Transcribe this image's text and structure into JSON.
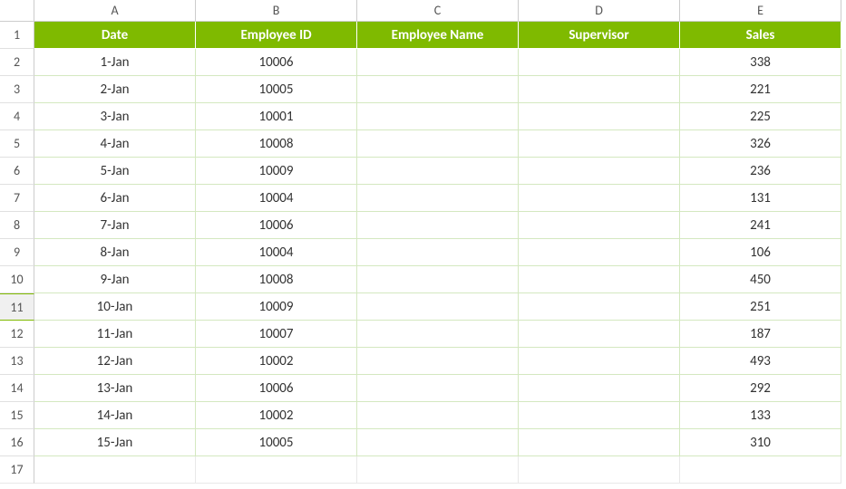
{
  "columns": [
    "A",
    "B",
    "C",
    "D",
    "E"
  ],
  "headers": {
    "A": "Date",
    "B": "Employee ID",
    "C": "Employee Name",
    "D": "Supervisor",
    "E": "Sales"
  },
  "rows": [
    {
      "n": "1"
    },
    {
      "n": "2",
      "A": "1-Jan",
      "B": "10006",
      "C": "",
      "D": "",
      "E": "338"
    },
    {
      "n": "3",
      "A": "2-Jan",
      "B": "10005",
      "C": "",
      "D": "",
      "E": "221"
    },
    {
      "n": "4",
      "A": "3-Jan",
      "B": "10001",
      "C": "",
      "D": "",
      "E": "225"
    },
    {
      "n": "5",
      "A": "4-Jan",
      "B": "10008",
      "C": "",
      "D": "",
      "E": "326"
    },
    {
      "n": "6",
      "A": "5-Jan",
      "B": "10009",
      "C": "",
      "D": "",
      "E": "236"
    },
    {
      "n": "7",
      "A": "6-Jan",
      "B": "10004",
      "C": "",
      "D": "",
      "E": "131"
    },
    {
      "n": "8",
      "A": "7-Jan",
      "B": "10006",
      "C": "",
      "D": "",
      "E": "241"
    },
    {
      "n": "9",
      "A": "8-Jan",
      "B": "10004",
      "C": "",
      "D": "",
      "E": "106"
    },
    {
      "n": "10",
      "A": "9-Jan",
      "B": "10008",
      "C": "",
      "D": "",
      "E": "450"
    },
    {
      "n": "11",
      "A": "10-Jan",
      "B": "10009",
      "C": "",
      "D": "",
      "E": "251"
    },
    {
      "n": "12",
      "A": "11-Jan",
      "B": "10007",
      "C": "",
      "D": "",
      "E": "187"
    },
    {
      "n": "13",
      "A": "12-Jan",
      "B": "10002",
      "C": "",
      "D": "",
      "E": "493"
    },
    {
      "n": "14",
      "A": "13-Jan",
      "B": "10006",
      "C": "",
      "D": "",
      "E": "292"
    },
    {
      "n": "15",
      "A": "14-Jan",
      "B": "10002",
      "C": "",
      "D": "",
      "E": "133"
    },
    {
      "n": "16",
      "A": "15-Jan",
      "B": "10005",
      "C": "",
      "D": "",
      "E": "310"
    },
    {
      "n": "17"
    }
  ],
  "selected_row": "11",
  "chart_data": {
    "type": "table",
    "columns": [
      "Date",
      "Employee ID",
      "Employee Name",
      "Supervisor",
      "Sales"
    ],
    "data": [
      [
        "1-Jan",
        10006,
        null,
        null,
        338
      ],
      [
        "2-Jan",
        10005,
        null,
        null,
        221
      ],
      [
        "3-Jan",
        10001,
        null,
        null,
        225
      ],
      [
        "4-Jan",
        10008,
        null,
        null,
        326
      ],
      [
        "5-Jan",
        10009,
        null,
        null,
        236
      ],
      [
        "6-Jan",
        10004,
        null,
        null,
        131
      ],
      [
        "7-Jan",
        10006,
        null,
        null,
        241
      ],
      [
        "8-Jan",
        10004,
        null,
        null,
        106
      ],
      [
        "9-Jan",
        10008,
        null,
        null,
        450
      ],
      [
        "10-Jan",
        10009,
        null,
        null,
        251
      ],
      [
        "11-Jan",
        10007,
        null,
        null,
        187
      ],
      [
        "12-Jan",
        10002,
        null,
        null,
        493
      ],
      [
        "13-Jan",
        10006,
        null,
        null,
        292
      ],
      [
        "14-Jan",
        10002,
        null,
        null,
        133
      ],
      [
        "15-Jan",
        10005,
        null,
        null,
        310
      ]
    ]
  }
}
